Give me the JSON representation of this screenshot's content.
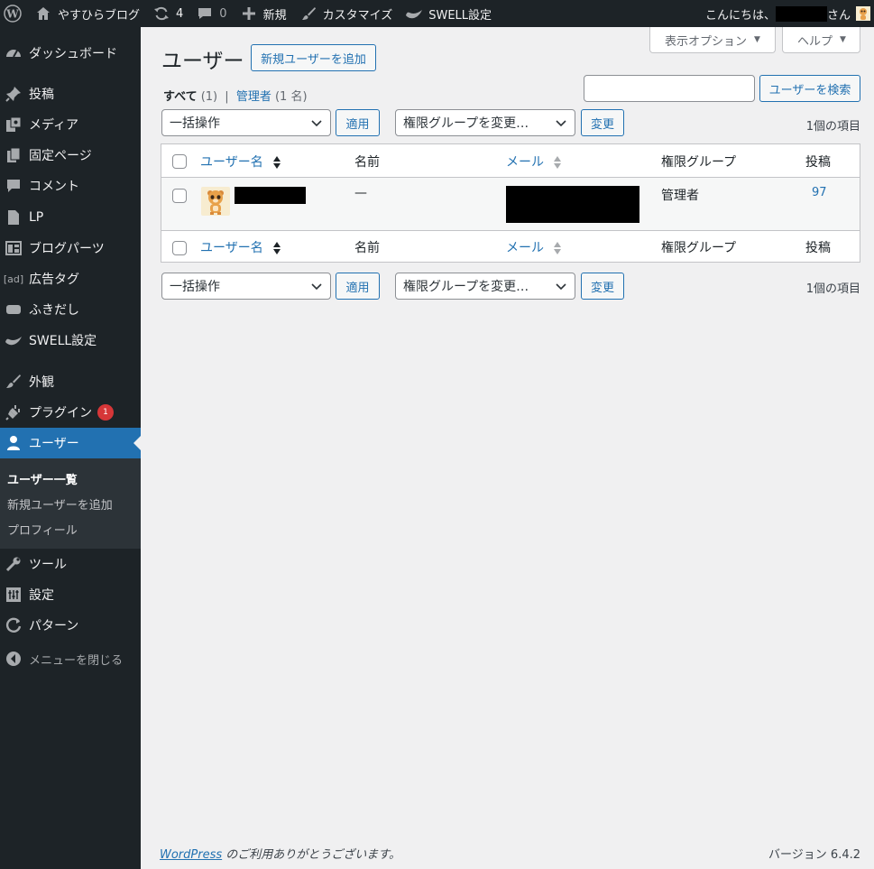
{
  "adminbar": {
    "site_name": "やすひらブログ",
    "updates_count": "4",
    "comments_count": "0",
    "new_label": "新規",
    "customize_label": "カスタマイズ",
    "swell_label": "SWELL設定",
    "greeting": "こんにちは、",
    "greeting_suffix": "さん"
  },
  "sidebar": {
    "items": [
      {
        "label": "ダッシュボード",
        "icon": "dashboard-icon"
      },
      {
        "label": "投稿",
        "icon": "pin-icon"
      },
      {
        "label": "メディア",
        "icon": "media-icon"
      },
      {
        "label": "固定ページ",
        "icon": "page-icon"
      },
      {
        "label": "コメント",
        "icon": "comment-icon"
      },
      {
        "label": "LP",
        "icon": "document-icon"
      },
      {
        "label": "ブログパーツ",
        "icon": "layout-icon"
      },
      {
        "label": "広告タグ",
        "icon": "ad-icon"
      },
      {
        "label": "ふきだし",
        "icon": "bubble-icon"
      },
      {
        "label": "SWELL設定",
        "icon": "swell-icon"
      },
      {
        "label": "外観",
        "icon": "brush-icon"
      },
      {
        "label": "プラグイン",
        "icon": "plugin-icon",
        "badge": "1"
      },
      {
        "label": "ユーザー",
        "icon": "user-icon",
        "current": true
      },
      {
        "label": "ツール",
        "icon": "wrench-icon"
      },
      {
        "label": "設定",
        "icon": "settings-icon"
      },
      {
        "label": "パターン",
        "icon": "patterns-icon"
      }
    ],
    "submenu": [
      "ユーザー一覧",
      "新規ユーザーを追加",
      "プロフィール"
    ],
    "collapse_label": "メニューを閉じる"
  },
  "screen_options_label": "表示オプション",
  "help_label": "ヘルプ",
  "page_title": "ユーザー",
  "add_new_label": "新規ユーザーを追加",
  "filters": {
    "all_label": "すべて",
    "all_count": "(1)",
    "separator": "|",
    "admin_label": "管理者",
    "admin_count": "(1 名)"
  },
  "search": {
    "value": "",
    "button_label": "ユーザーを検索"
  },
  "bulk": {
    "action_label": "一括操作",
    "apply_label": "適用",
    "role_label": "権限グループを変更…",
    "change_label": "変更",
    "items_count": "1個の項目"
  },
  "table": {
    "columns": {
      "username": "ユーザー名",
      "name": "名前",
      "email": "メール",
      "role": "権限グループ",
      "posts": "投稿"
    },
    "rows": [
      {
        "name": "—",
        "role": "管理者",
        "posts": "97"
      }
    ]
  },
  "footer": {
    "wp_link": "WordPress",
    "thanks": " のご利用ありがとうございます。",
    "version": "バージョン 6.4.2"
  }
}
